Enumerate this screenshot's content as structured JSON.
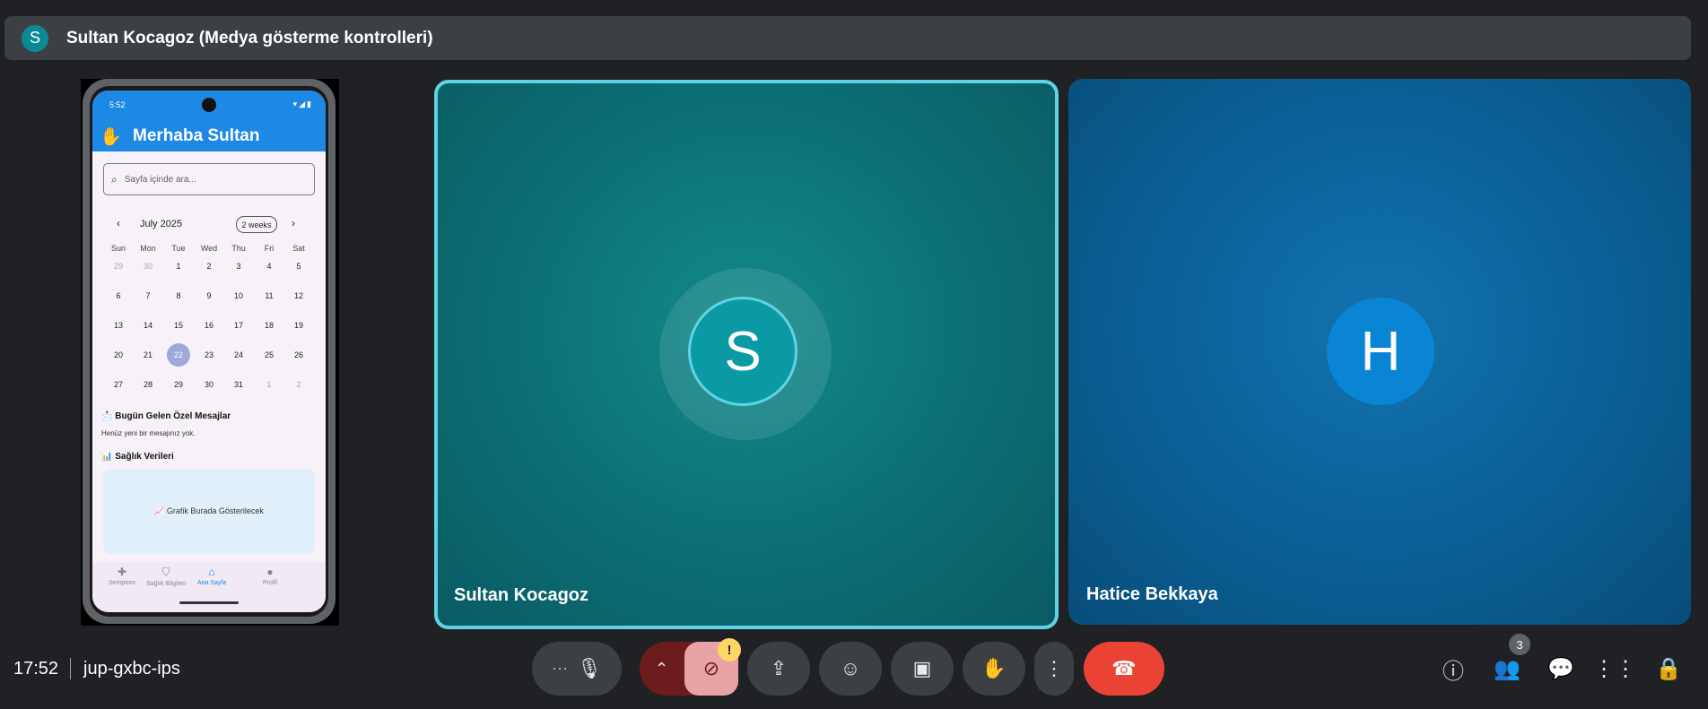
{
  "topbar": {
    "avatar_letter": "S",
    "title": "Sultan Kocagoz (Medya gösterme kontrolleri)"
  },
  "phone": {
    "status_time": "5:52",
    "app_title": "Merhaba Sultan",
    "search_placeholder": "Sayfa içinde ara...",
    "calendar": {
      "month": "July 2025",
      "range_button": "2 weeks",
      "weekdays": [
        "Sun",
        "Mon",
        "Tue",
        "Wed",
        "Thu",
        "Fri",
        "Sat"
      ],
      "weeks": [
        [
          "29",
          "30",
          "1",
          "2",
          "3",
          "4",
          "5"
        ],
        [
          "6",
          "7",
          "8",
          "9",
          "10",
          "11",
          "12"
        ],
        [
          "13",
          "14",
          "15",
          "16",
          "17",
          "18",
          "19"
        ],
        [
          "20",
          "21",
          "22",
          "23",
          "24",
          "25",
          "26"
        ],
        [
          "27",
          "28",
          "29",
          "30",
          "31",
          "1",
          "2"
        ]
      ],
      "selected_day": "22"
    },
    "messages_title": "📩 Bugün Gelen Özel Mesajlar",
    "messages_text": "Henüz yeni bir mesajınız yok.",
    "health_title": "📊 Sağlık Verileri",
    "chart_placeholder": "📈 Grafik Burada Gösterilecek",
    "nav": [
      {
        "label": "Semptom",
        "icon": "bandage-icon"
      },
      {
        "label": "Sağlık Bilgileri",
        "icon": "shield-icon"
      },
      {
        "label": "Ana Sayfa",
        "icon": "home-icon"
      },
      {
        "label": "Profil",
        "icon": "profile-icon"
      }
    ]
  },
  "tiles": [
    {
      "name": "Sultan Kocagoz",
      "letter": "S",
      "color": "#0b9aa4"
    },
    {
      "name": "Hatice Bekkaya",
      "letter": "H",
      "color": "#0a85d4"
    }
  ],
  "footer": {
    "time": "17:52",
    "meeting_code": "jup-gxbc-ips",
    "participants_count": "3",
    "end_call_color": "#ea4335"
  }
}
